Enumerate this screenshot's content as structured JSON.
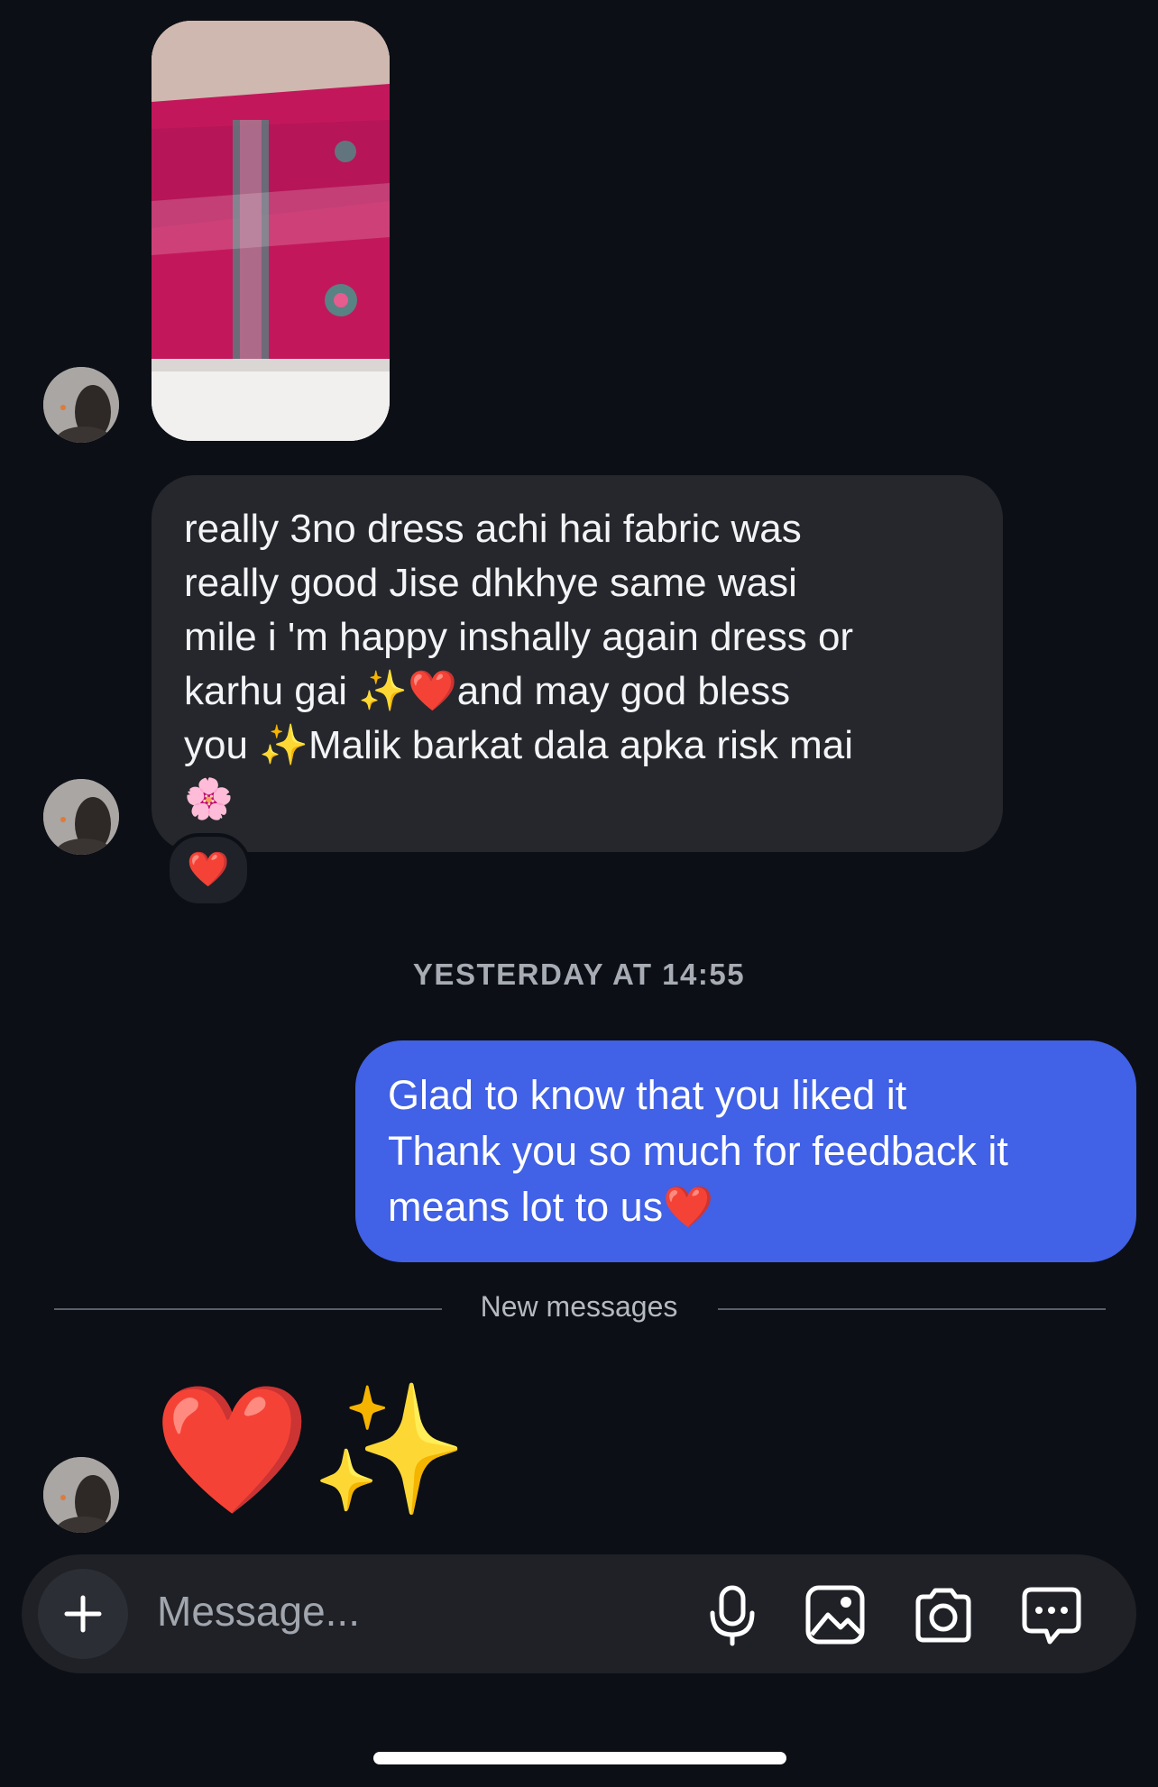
{
  "conversation": {
    "incoming_message": {
      "text": "really 3no dress achi hai fabric was\nreally good Jise dhkhye same wasi\nmile i 'm happy inshally again dress or\nkarhu gai ✨❤️and may god bless\nyou ✨Malik barkat dala apka risk mai\n🌸",
      "reaction": "❤️"
    },
    "timestamp": "YESTERDAY AT 14:55",
    "outgoing_message": {
      "text": "Glad to know that you liked it\nThank you so much for feedback it\nmeans lot to us❤️"
    },
    "new_messages_divider": "New messages",
    "emoji_message": "❤️✨"
  },
  "composer": {
    "placeholder": "Message...",
    "icons": [
      "plus-icon",
      "microphone-icon",
      "gallery-icon",
      "camera-icon",
      "sticker-chat-icon"
    ]
  },
  "colors": {
    "background": "#0c0f15",
    "incoming_bubble": "#25272d",
    "outgoing_bubble": "#4161e6"
  }
}
